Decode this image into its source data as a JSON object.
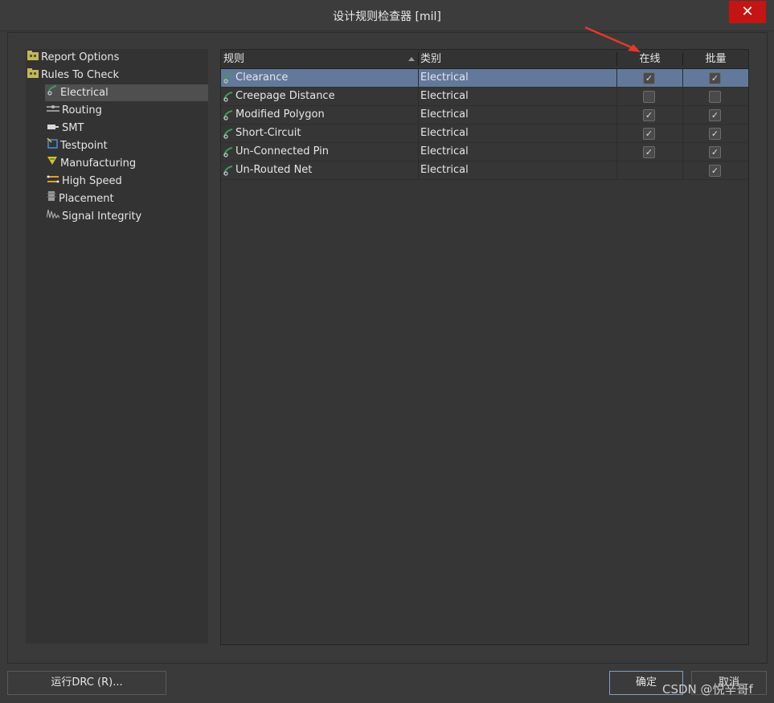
{
  "window": {
    "title": "设计规则检查器 [mil]",
    "close_icon": "close-icon",
    "close_glyph": "✕"
  },
  "tree": {
    "items": [
      {
        "label": "Report Options",
        "icon": "folder-icon",
        "level": 0,
        "selected": false
      },
      {
        "label": "Rules To Check",
        "icon": "folder-icon",
        "level": 0,
        "selected": false
      },
      {
        "label": "Electrical",
        "icon": "electrical-rule-icon",
        "level": 1,
        "selected": true
      },
      {
        "label": "Routing",
        "icon": "routing-icon",
        "level": 1,
        "selected": false
      },
      {
        "label": "SMT",
        "icon": "smt-icon",
        "level": 1,
        "selected": false
      },
      {
        "label": "Testpoint",
        "icon": "testpoint-icon",
        "level": 1,
        "selected": false
      },
      {
        "label": "Manufacturing",
        "icon": "manufacturing-icon",
        "level": 1,
        "selected": false
      },
      {
        "label": "High Speed",
        "icon": "high-speed-icon",
        "level": 1,
        "selected": false
      },
      {
        "label": "Placement",
        "icon": "placement-icon",
        "level": 1,
        "selected": false
      },
      {
        "label": "Signal Integrity",
        "icon": "signal-integrity-icon",
        "level": 1,
        "selected": false
      }
    ]
  },
  "grid": {
    "headers": {
      "rule": "规则",
      "category": "类别",
      "online": "在线",
      "batch": "批量"
    },
    "rows": [
      {
        "rule": "Clearance",
        "category": "Electrical",
        "online": true,
        "batch": true,
        "selected": true,
        "online_shown": true
      },
      {
        "rule": "Creepage Distance",
        "category": "Electrical",
        "online": false,
        "batch": false,
        "selected": false,
        "online_shown": true
      },
      {
        "rule": "Modified Polygon",
        "category": "Electrical",
        "online": true,
        "batch": true,
        "selected": false,
        "online_shown": true
      },
      {
        "rule": "Short-Circuit",
        "category": "Electrical",
        "online": true,
        "batch": true,
        "selected": false,
        "online_shown": true
      },
      {
        "rule": "Un-Connected Pin",
        "category": "Electrical",
        "online": true,
        "batch": true,
        "selected": false,
        "online_shown": true
      },
      {
        "rule": "Un-Routed Net",
        "category": "Electrical",
        "online": false,
        "batch": true,
        "selected": false,
        "online_shown": false
      }
    ]
  },
  "buttons": {
    "run_drc": "运行DRC (R)...",
    "ok": "确定",
    "cancel": "取消"
  },
  "watermark": "CSDN @悦辛哥f",
  "colors": {
    "selection": "#62799b",
    "close_red": "#c41414",
    "annotation_arrow": "#e03a2a"
  }
}
